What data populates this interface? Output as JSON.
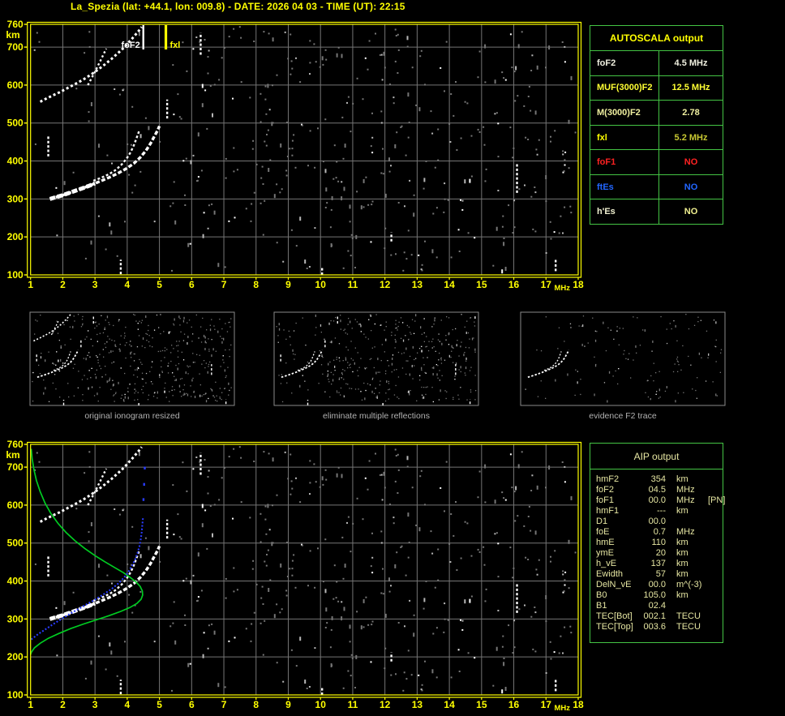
{
  "title": "La_Spezia (lat: +44.1, lon: 009.8) - DATE: 2026 04 03 - TIME (UT): 22:15",
  "autoscala_table": {
    "header": "AUTOSCALA output",
    "rows": [
      {
        "label": "foF2",
        "value": "4.5 MHz",
        "label_color": "#f0f0e0",
        "value_color": "#f0f0e0"
      },
      {
        "label": "MUF(3000)F2",
        "value": "12.5 MHz",
        "label_color": "#ffff33",
        "value_color": "#ffff33"
      },
      {
        "label": "M(3000)F2",
        "value": "2.78",
        "label_color": "#f0f0a0",
        "value_color": "#f0f0a0"
      },
      {
        "label": "fxl",
        "value": "5.2 MHz",
        "label_color": "#ffff00",
        "value_color": "#c8c832"
      },
      {
        "label": "foF1",
        "value": "NO",
        "label_color": "#ff2222",
        "value_color": "#ff2222"
      },
      {
        "label": "ftEs",
        "value": "NO",
        "label_color": "#2266ff",
        "value_color": "#2266ff"
      },
      {
        "label": "h'Es",
        "value": "NO",
        "label_color": "#f0f0d0",
        "value_color": "#f0f090"
      }
    ]
  },
  "aip_table": {
    "header": "AIP output",
    "rows": [
      [
        "hmF2",
        "354",
        "km",
        ""
      ],
      [
        "foF2",
        "04.5",
        "MHz",
        ""
      ],
      [
        "foF1",
        "00.0",
        "MHz",
        "[PN]"
      ],
      [
        "hmF1",
        "---",
        "km",
        ""
      ],
      [
        "D1",
        "00.0",
        "",
        ""
      ],
      [
        "foE",
        "0.7",
        "MHz",
        ""
      ],
      [
        "hmE",
        "110",
        "km",
        ""
      ],
      [
        "ymE",
        "20",
        "km",
        ""
      ],
      [
        "h_vE",
        "137",
        "km",
        ""
      ],
      [
        "Ewidth",
        "57",
        "km",
        ""
      ],
      [
        "DelN_vE",
        "00.0",
        "m^(-3)",
        ""
      ],
      [
        "B0",
        "105.0",
        "km",
        ""
      ],
      [
        "B1",
        "02.4",
        "",
        ""
      ],
      [
        "TEC[Bot]",
        "002.1",
        "TECU",
        ""
      ],
      [
        "TEC[Top]",
        "003.6",
        "TECU",
        ""
      ]
    ]
  },
  "panel_captions": [
    "original ionogram resized",
    "eliminate multiple reflections",
    "evidence F2 trace"
  ],
  "axes": {
    "x_ticks": [
      1,
      2,
      3,
      4,
      5,
      6,
      7,
      8,
      9,
      10,
      11,
      12,
      13,
      14,
      15,
      16,
      17,
      18
    ],
    "x_unit": "MHz",
    "y_ticks": [
      760,
      700,
      600,
      500,
      400,
      300,
      200,
      100
    ],
    "y_unit": "km"
  },
  "markers": {
    "foF2": {
      "label": "foF2",
      "mhz": 4.5,
      "color": "#ffffff"
    },
    "fxl": {
      "label": "fxl",
      "mhz": 5.2,
      "color": "#ffff00"
    }
  },
  "colors": {
    "accent_yellow": "#ffff00",
    "grid": "#757575",
    "noise_gray": "#7a7a7a",
    "trace_white": "#ffffff",
    "profile_green": "#00cc22",
    "trace_blue": "#2a3cff",
    "table_border_green": "#44c444",
    "caption_gray": "#b2b2b2",
    "aip_text": "#e6e6a2",
    "panel_border_gray": "#8a8a8a"
  },
  "chart_data": {
    "type": "scatter",
    "title": "ionogram (virtual height vs frequency)",
    "xlabel": "MHz",
    "ylabel": "km",
    "x_range": [
      1,
      18
    ],
    "y_range": [
      100,
      760
    ],
    "series": [
      {
        "name": "f2_trace_main",
        "points": [
          [
            1.6,
            300
          ],
          [
            1.8,
            305
          ],
          [
            2.0,
            310
          ],
          [
            2.2,
            316
          ],
          [
            2.4,
            322
          ],
          [
            2.6,
            328
          ],
          [
            2.8,
            334
          ],
          [
            3.0,
            341
          ],
          [
            3.2,
            348
          ],
          [
            3.45,
            357
          ],
          [
            3.7,
            367
          ],
          [
            3.95,
            379
          ],
          [
            4.2,
            393
          ],
          [
            4.4,
            409
          ],
          [
            4.58,
            427
          ],
          [
            4.73,
            447
          ],
          [
            4.85,
            466
          ],
          [
            4.94,
            480
          ],
          [
            5.0,
            492
          ]
        ]
      },
      {
        "name": "f2_trace_o_branch",
        "points": [
          [
            2.95,
            348
          ],
          [
            3.2,
            356
          ],
          [
            3.45,
            366
          ],
          [
            3.65,
            377
          ],
          [
            3.82,
            390
          ],
          [
            3.97,
            405
          ],
          [
            4.1,
            422
          ],
          [
            4.2,
            440
          ],
          [
            4.28,
            458
          ],
          [
            4.34,
            472
          ],
          [
            4.38,
            482
          ]
        ]
      },
      {
        "name": "second_hop_trace",
        "points": [
          [
            1.3,
            556
          ],
          [
            1.5,
            565
          ],
          [
            1.7,
            573
          ],
          [
            1.9,
            581
          ],
          [
            2.1,
            590
          ],
          [
            2.3,
            599
          ],
          [
            2.5,
            608
          ],
          [
            2.7,
            618
          ],
          [
            2.9,
            629
          ],
          [
            3.1,
            641
          ],
          [
            3.3,
            654
          ],
          [
            3.5,
            668
          ],
          [
            3.7,
            683
          ],
          [
            3.9,
            699
          ],
          [
            4.05,
            713
          ],
          [
            4.2,
            727
          ],
          [
            4.35,
            742
          ],
          [
            4.45,
            753
          ]
        ]
      },
      {
        "name": "second_hop_branch",
        "points": [
          [
            2.78,
            600
          ],
          [
            2.88,
            616
          ],
          [
            2.98,
            632
          ],
          [
            3.08,
            649
          ],
          [
            3.18,
            666
          ],
          [
            3.28,
            684
          ],
          [
            3.35,
            696
          ]
        ]
      },
      {
        "name": "profile_green",
        "points": [
          [
            1.02,
            748
          ],
          [
            1.05,
            722
          ],
          [
            1.1,
            695
          ],
          [
            1.18,
            665
          ],
          [
            1.3,
            635
          ],
          [
            1.45,
            605
          ],
          [
            1.63,
            578
          ],
          [
            1.85,
            552
          ],
          [
            2.1,
            528
          ],
          [
            2.38,
            506
          ],
          [
            2.68,
            486
          ],
          [
            3.0,
            467
          ],
          [
            3.3,
            451
          ],
          [
            3.6,
            436
          ],
          [
            3.88,
            422
          ],
          [
            4.1,
            409
          ],
          [
            4.28,
            397
          ],
          [
            4.4,
            386
          ],
          [
            4.47,
            374
          ],
          [
            4.48,
            363
          ],
          [
            4.43,
            352
          ],
          [
            4.3,
            341
          ],
          [
            4.08,
            330
          ],
          [
            3.8,
            320
          ],
          [
            3.45,
            309
          ],
          [
            3.05,
            298
          ],
          [
            2.65,
            287
          ],
          [
            2.25,
            275
          ],
          [
            1.88,
            262
          ],
          [
            1.55,
            249
          ],
          [
            1.3,
            236
          ],
          [
            1.12,
            224
          ],
          [
            1.02,
            212
          ],
          [
            1.0,
            206
          ]
        ]
      },
      {
        "name": "restored_trace_blue",
        "points": [
          [
            1.02,
            246
          ],
          [
            1.25,
            261
          ],
          [
            1.5,
            275
          ],
          [
            1.75,
            289
          ],
          [
            2.0,
            302
          ],
          [
            2.25,
            315
          ],
          [
            2.5,
            327
          ],
          [
            2.75,
            339
          ],
          [
            3.0,
            351
          ],
          [
            3.25,
            364
          ],
          [
            3.5,
            378
          ],
          [
            3.7,
            392
          ],
          [
            3.88,
            407
          ],
          [
            4.03,
            423
          ],
          [
            4.15,
            440
          ],
          [
            4.25,
            457
          ],
          [
            4.32,
            474
          ],
          [
            4.38,
            492
          ],
          [
            4.42,
            510
          ],
          [
            4.45,
            528
          ],
          [
            4.47,
            548
          ],
          [
            4.49,
            566
          ]
        ]
      },
      {
        "name": "blue_isolated_dots",
        "points": [
          [
            4.5,
            615
          ],
          [
            4.52,
            655
          ],
          [
            4.54,
            698
          ]
        ]
      }
    ],
    "echo_features_f_km1_km2": [
      [
        1.55,
        412,
        468
      ],
      [
        3.8,
        102,
        140
      ],
      [
        5.24,
        512,
        562
      ],
      [
        6.28,
        680,
        738
      ],
      [
        10.05,
        100,
        118
      ],
      [
        12.2,
        188,
        212
      ],
      [
        16.1,
        316,
        392
      ],
      [
        17.3,
        110,
        142
      ]
    ]
  }
}
